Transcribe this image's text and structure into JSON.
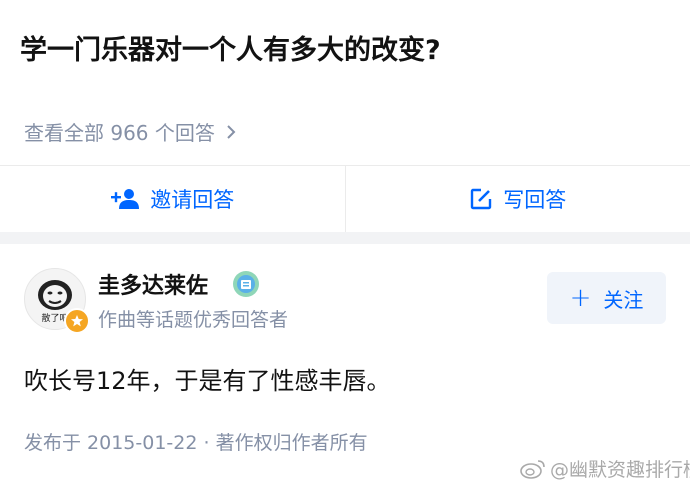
{
  "question": {
    "title": "学一门乐器对一个人有多大的改变?",
    "view_all_label": "查看全部 966 个回答"
  },
  "actions": {
    "invite_label": "邀请回答",
    "write_label": "写回答"
  },
  "author": {
    "name": "圭多达莱佐",
    "description": "作曲等话题优秀回答者",
    "avatar_caption": "散了吧"
  },
  "follow_button": {
    "plus": "+",
    "label": "关注"
  },
  "answer": {
    "text": "吹长号12年，于是有了性感丰唇。",
    "meta": "发布于 2015-01-22 · 著作权归作者所有"
  },
  "watermark": {
    "text": "@幽默资趣排行榜"
  },
  "colors": {
    "accent": "#0066ff",
    "muted": "#8590a6",
    "follow_bg": "#f0f4fa",
    "badge": "#f5a623"
  }
}
